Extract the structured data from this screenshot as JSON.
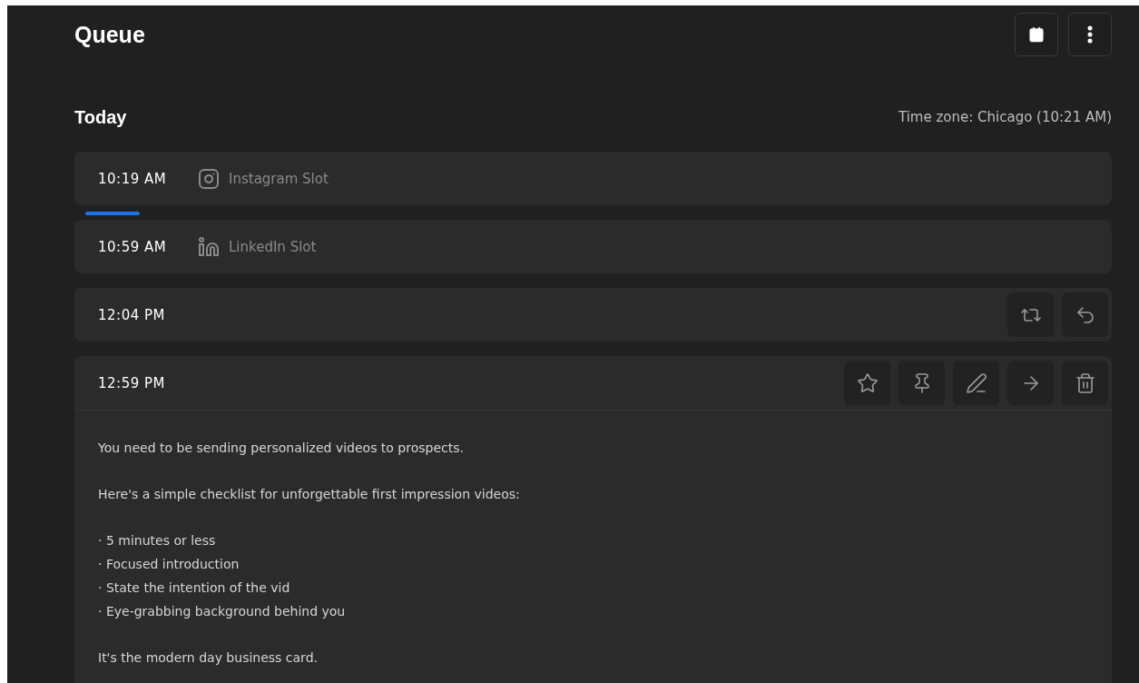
{
  "title": "Queue",
  "section": {
    "title": "Today",
    "time_zone": "Time zone: Chicago (10:21 AM)"
  },
  "slots": [
    {
      "time": "10:19 AM",
      "kind": "instagram",
      "label": "Instagram Slot",
      "now_after": true
    },
    {
      "time": "10:59 AM",
      "kind": "linkedin",
      "label": "LinkedIn Slot",
      "now_after": false
    },
    {
      "time": "12:04 PM",
      "kind": "post",
      "actions": [
        {
          "kind": "repost"
        },
        {
          "kind": "reply"
        }
      ],
      "now_after": false
    },
    {
      "time": "12:59 PM",
      "kind": "post",
      "actions": [
        {
          "kind": "star"
        },
        {
          "kind": "pin"
        },
        {
          "kind": "edit"
        },
        {
          "kind": "move"
        },
        {
          "kind": "delete"
        }
      ],
      "now_after": false,
      "expanded": true,
      "body": [
        [
          "You need to be sending personalized videos to prospects."
        ],
        [
          "Here's a simple checklist for unforgettable first impression videos:"
        ],
        [
          "· 5 minutes or less",
          "· Focused introduction",
          "· State the intention of the vid",
          "· Eye-grabbing background behind you"
        ],
        [
          "It's the modern day business card."
        ]
      ]
    }
  ]
}
